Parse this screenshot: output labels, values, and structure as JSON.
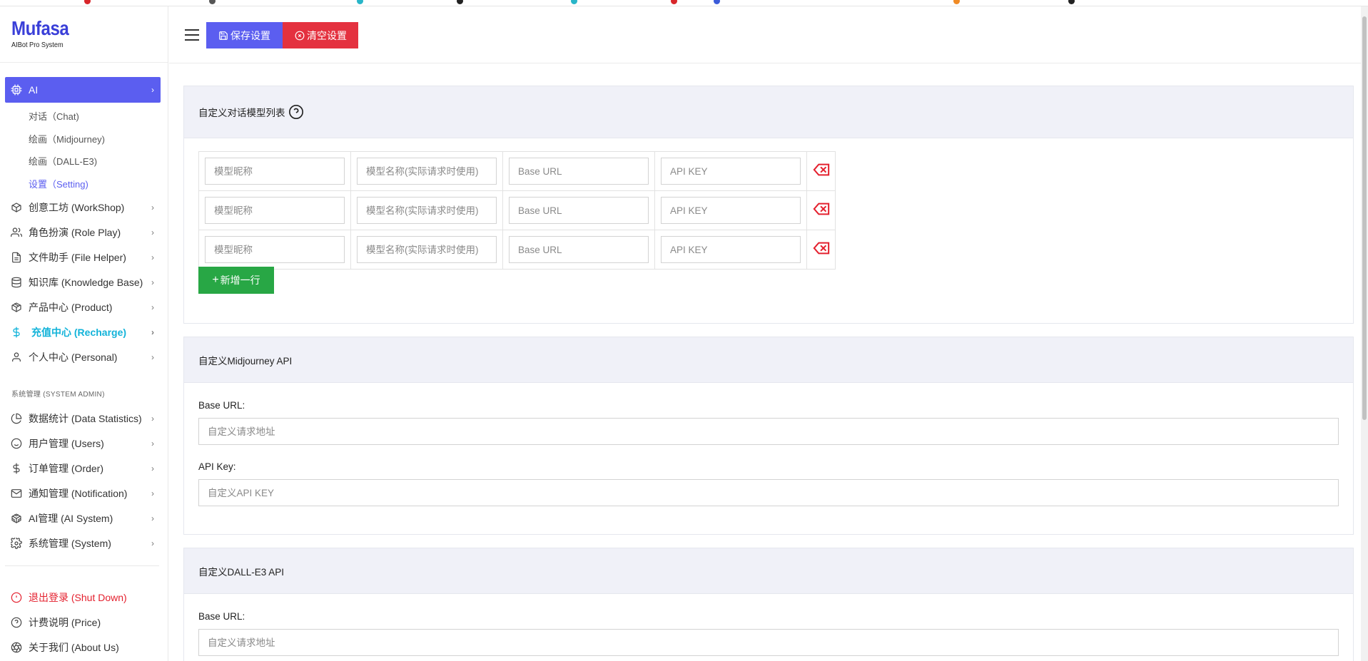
{
  "brand": {
    "title": "Mufasa",
    "subtitle": "AIBot Pro System"
  },
  "toolbar": {
    "save_label": "保存设置",
    "clear_label": "清空设置"
  },
  "nav": {
    "ai": {
      "label": "AI"
    },
    "ai_sub": [
      "对话（Chat)",
      "绘画（Midjourney)",
      "绘画（DALL-E3)",
      "设置（Setting)"
    ],
    "items": [
      {
        "label": "创意工坊 (WorkShop)",
        "icon": "box-icon"
      },
      {
        "label": "角色扮演 (Role Play)",
        "icon": "users-icon"
      },
      {
        "label": "文件助手 (File Helper)",
        "icon": "file-icon"
      },
      {
        "label": "知识库 (Knowledge Base)",
        "icon": "database-icon"
      },
      {
        "label": "产品中心 (Product)",
        "icon": "package-icon"
      },
      {
        "label": "充值中心 (Recharge)",
        "icon": "dollar-icon"
      },
      {
        "label": "个人中心 (Personal)",
        "icon": "user-icon"
      }
    ],
    "admin_section": "系统管理 (SYSTEM ADMIN)",
    "admin_items": [
      {
        "label": "数据统计 (Data Statistics)",
        "icon": "pie-chart-icon"
      },
      {
        "label": "用户管理 (Users)",
        "icon": "smile-icon"
      },
      {
        "label": "订单管理 (Order)",
        "icon": "dollar-icon"
      },
      {
        "label": "通知管理 (Notification)",
        "icon": "mail-icon"
      },
      {
        "label": "AI管理 (AI System)",
        "icon": "codesandbox-icon"
      },
      {
        "label": "系统管理 (System)",
        "icon": "settings-icon"
      }
    ],
    "footer_items": [
      {
        "label": "退出登录 (Shut Down)",
        "icon": "alert-circle-icon"
      },
      {
        "label": "计费说明 (Price)",
        "icon": "help-circle-icon"
      },
      {
        "label": "关于我们 (About Us)",
        "icon": "aperture-icon"
      }
    ]
  },
  "models_card": {
    "title": "自定义对话模型列表",
    "placeholders": {
      "nickname": "模型昵称",
      "name": "模型名称(实际请求时使用)",
      "base_url": "Base URL",
      "api_key": "API KEY"
    },
    "rows": 3,
    "add_label": "新增一行"
  },
  "mj_card": {
    "title": "自定义Midjourney API",
    "base_url_label": "Base URL:",
    "base_url_placeholder": "自定义请求地址",
    "api_key_label": "API Key:",
    "api_key_placeholder": "自定义API KEY"
  },
  "dalle_card": {
    "title": "自定义DALL-E3 API",
    "base_url_label": "Base URL:",
    "base_url_placeholder": "自定义请求地址"
  },
  "colors": {
    "primary": "#5b5ef0",
    "danger": "#e4313f",
    "success": "#28a745",
    "recharge": "#12b3d9"
  }
}
